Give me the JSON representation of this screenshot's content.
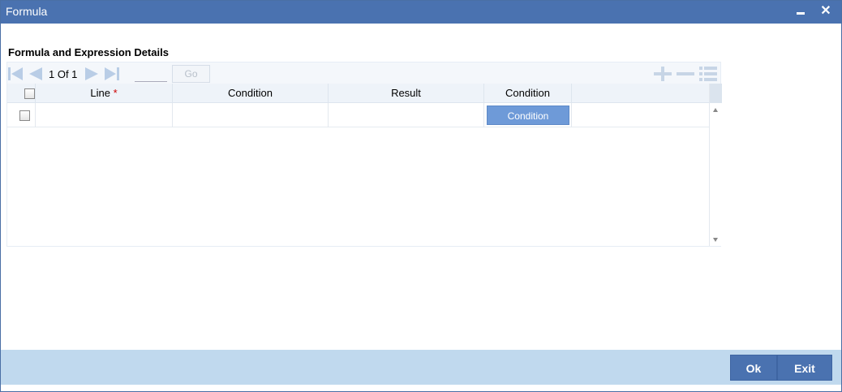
{
  "window": {
    "title": "Formula",
    "minimize_icon": "minimize-icon",
    "close_icon": "close-icon",
    "close_glyph": "✕"
  },
  "section": {
    "title": "Formula and Expression Details"
  },
  "toolbar": {
    "page_text": "1 Of 1",
    "page_input": "",
    "go_label": "Go",
    "icons": [
      "first-page-icon",
      "previous-page-icon",
      "next-page-icon",
      "last-page-icon",
      "add-row-icon",
      "delete-row-icon",
      "single-view-icon"
    ]
  },
  "table": {
    "columns": [
      {
        "label": "Line",
        "required": true
      },
      {
        "label": "Condition",
        "required": false
      },
      {
        "label": "Result",
        "required": false
      },
      {
        "label": "Condition",
        "required": false
      }
    ],
    "required_mark": "*",
    "rows": [
      {
        "line": "",
        "condition": "",
        "result": "",
        "condition_button": "Condition"
      }
    ]
  },
  "footer": {
    "ok_label": "Ok",
    "exit_label": "Exit"
  },
  "colors": {
    "titlebar": "#4a72b0",
    "footer": "#c0d9ee",
    "button": "#4a72b0",
    "condition_button": "#6e9ad8",
    "nav_icon": "#b9cde6",
    "required": "#cc0000"
  }
}
